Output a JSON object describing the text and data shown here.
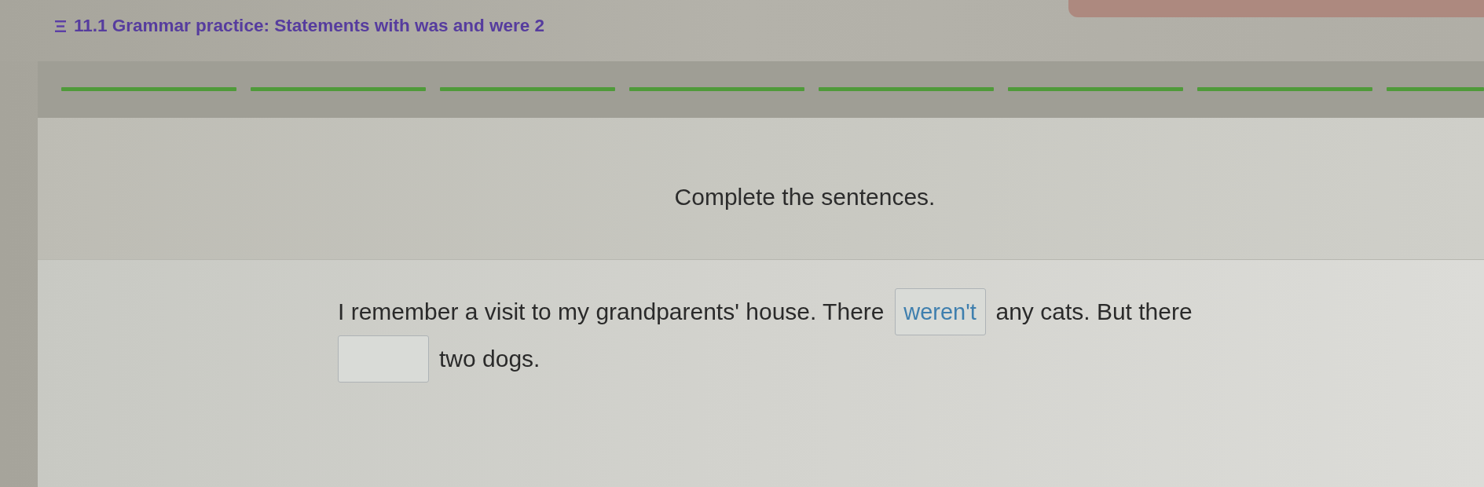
{
  "header": {
    "title": "11.1 Grammar practice: Statements with was and were 2"
  },
  "progress": {
    "segments": [
      {
        "completed": true
      },
      {
        "completed": true
      },
      {
        "completed": true
      },
      {
        "completed": true
      },
      {
        "completed": true
      },
      {
        "completed": true
      },
      {
        "completed": true
      },
      {
        "completed": true
      }
    ]
  },
  "instructions": "Complete the sentences.",
  "exercise": {
    "parts": [
      {
        "kind": "text",
        "text": "I remember a visit to my grandparents' house. There"
      },
      {
        "kind": "blank",
        "value": "weren't"
      },
      {
        "kind": "text",
        "text": "any cats. But there"
      },
      {
        "kind": "blank"
      },
      {
        "kind": "text",
        "text": "two dogs."
      }
    ]
  }
}
